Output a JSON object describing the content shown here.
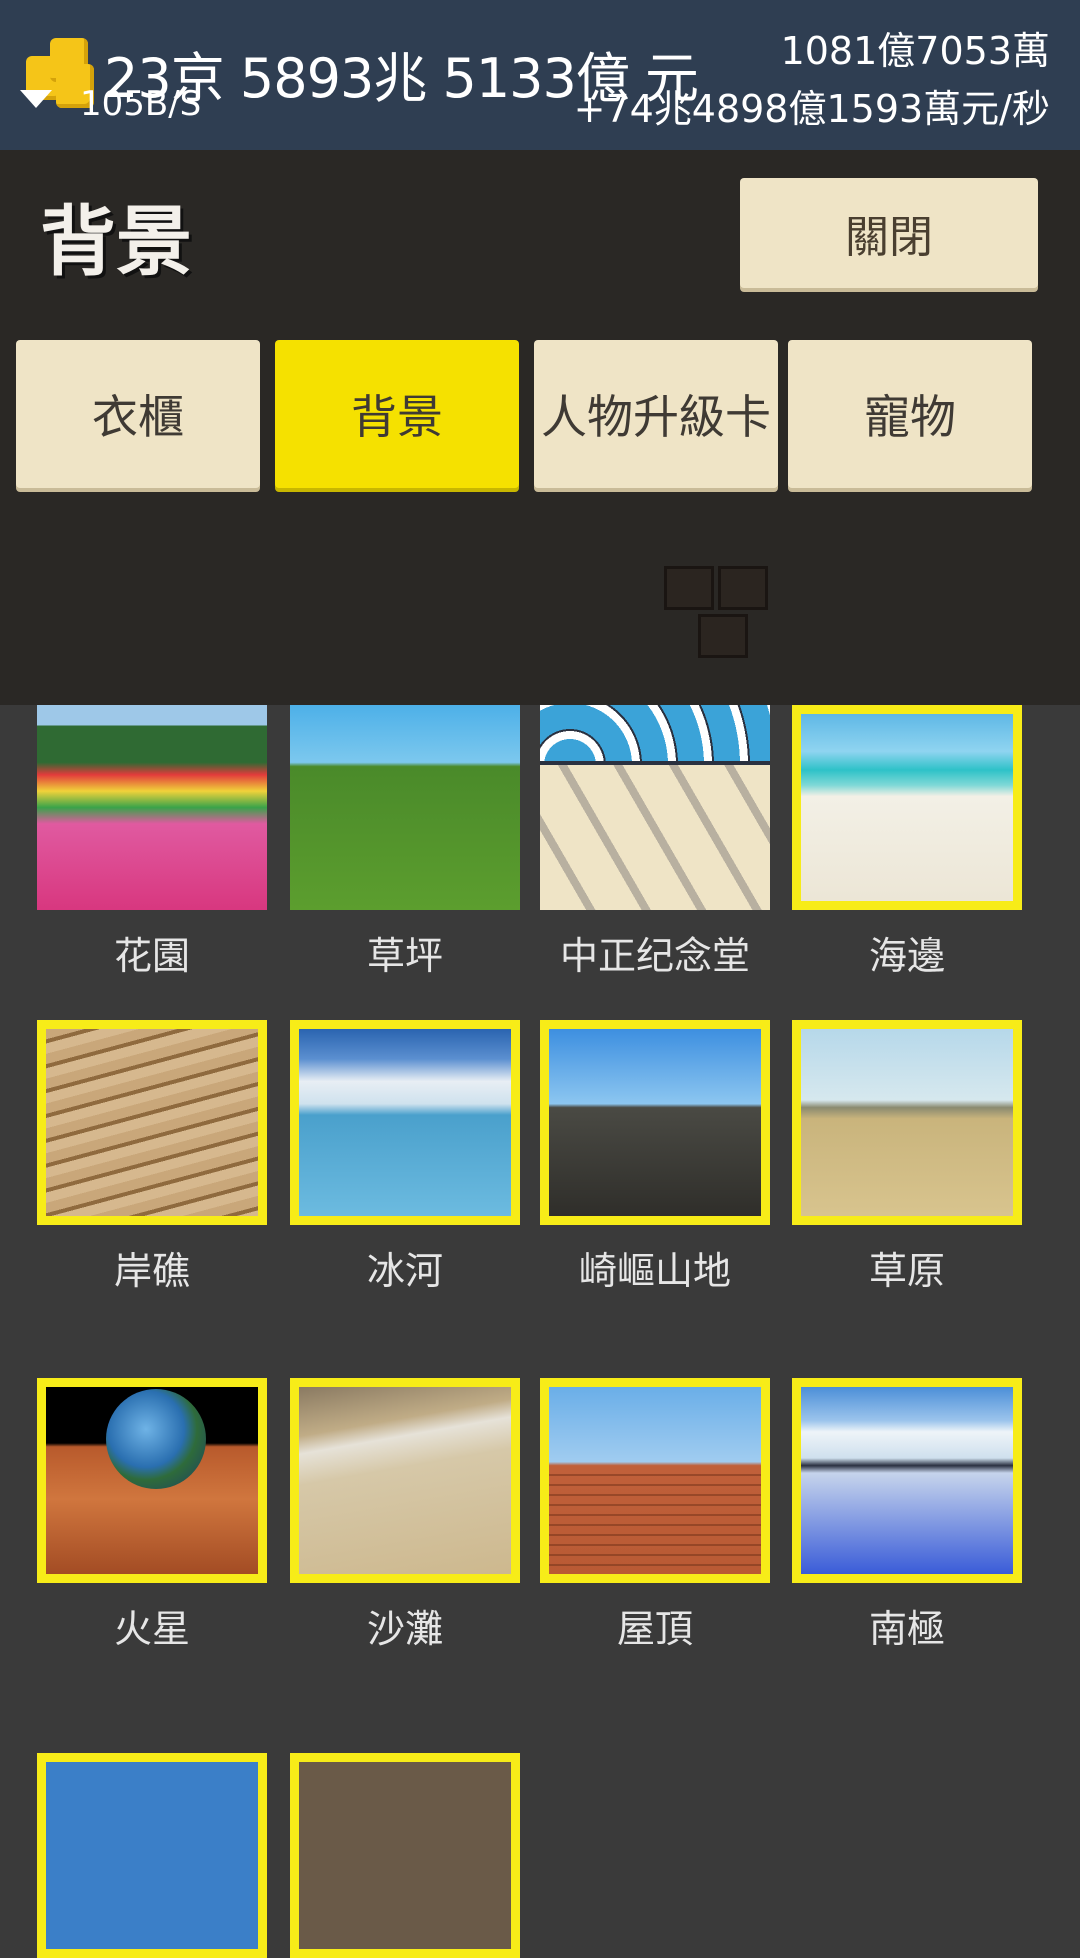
{
  "status": {
    "total_money": "23京 5893兆 5133億 元",
    "network_speed": "105B/S",
    "secondary_money": "1081億7053萬",
    "income_rate": "+74兆4898億1593萬元/秒",
    "icons": [
      "coins-icon",
      "wifi-icon"
    ]
  },
  "panel": {
    "title": "背景",
    "close_label": "關閉",
    "tabs": [
      {
        "label": "衣櫃",
        "active": false
      },
      {
        "label": "背景",
        "active": true
      },
      {
        "label": "人物升級卡",
        "active": false
      },
      {
        "label": "寵物",
        "active": false
      }
    ]
  },
  "backgrounds": [
    {
      "label": "花園",
      "selected": false
    },
    {
      "label": "草坪",
      "selected": false
    },
    {
      "label": "中正纪念堂",
      "selected": false
    },
    {
      "label": "海邊",
      "selected": true
    },
    {
      "label": "岸礁",
      "selected": true
    },
    {
      "label": "冰河",
      "selected": true
    },
    {
      "label": "崎嶇山地",
      "selected": true
    },
    {
      "label": "草原",
      "selected": true
    },
    {
      "label": "火星",
      "selected": true
    },
    {
      "label": "沙灘",
      "selected": true
    },
    {
      "label": "屋頂",
      "selected": true
    },
    {
      "label": "南極",
      "selected": true
    }
  ],
  "colors": {
    "topbar": "#2f3e52",
    "panel": "#2a2825",
    "button": "#efe4c6",
    "active_tab": "#f5e100",
    "frame": "#f7ec18"
  }
}
